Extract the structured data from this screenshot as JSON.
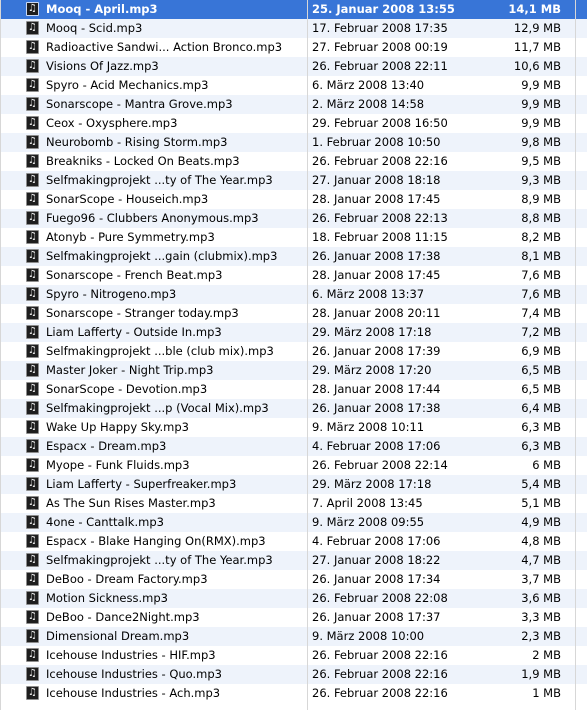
{
  "selection_color": "#3875d7",
  "stripe_color": "#eef3fb",
  "file_icon": "music-file-icon",
  "files": [
    {
      "name": "Mooq - April.mp3",
      "date": "25. Januar 2008 13:55",
      "size": "14,1 MB",
      "selected": true
    },
    {
      "name": "Mooq - Scid.mp3",
      "date": "17. Februar 2008 17:35",
      "size": "12,9 MB"
    },
    {
      "name": "Radioactive Sandwi... Action Bronco.mp3",
      "date": "27. Februar 2008 00:19",
      "size": "11,7 MB"
    },
    {
      "name": "Visions Of Jazz.mp3",
      "date": "26. Februar 2008 22:11",
      "size": "10,6 MB"
    },
    {
      "name": "Spyro - Acid Mechanics.mp3",
      "date": "6. März 2008 13:40",
      "size": "9,9 MB"
    },
    {
      "name": "Sonarscope - Mantra Grove.mp3",
      "date": "2. März 2008 14:58",
      "size": "9,9 MB"
    },
    {
      "name": "Ceox - Oxysphere.mp3",
      "date": "29. Februar 2008 16:50",
      "size": "9,9 MB"
    },
    {
      "name": "Neurobomb - Rising Storm.mp3",
      "date": "1. Februar 2008 10:50",
      "size": "9,8 MB"
    },
    {
      "name": "Breakniks - Locked On Beats.mp3",
      "date": "26. Februar 2008 22:16",
      "size": "9,5 MB"
    },
    {
      "name": "Selfmakingprojekt ...ty of The Year.mp3",
      "date": "27. Januar 2008 18:18",
      "size": "9,3 MB"
    },
    {
      "name": "SonarScope - Houseich.mp3",
      "date": "28. Januar 2008 17:45",
      "size": "8,9 MB"
    },
    {
      "name": "Fuego96 - Clubbers Anonymous.mp3",
      "date": "26. Februar 2008 22:13",
      "size": "8,8 MB"
    },
    {
      "name": "Atonyb - Pure Symmetry.mp3",
      "date": "18. Februar 2008 11:15",
      "size": "8,2 MB"
    },
    {
      "name": "Selfmakingprojekt ...gain (clubmix).mp3",
      "date": "26. Januar 2008 17:38",
      "size": "8,1 MB"
    },
    {
      "name": "Sonarscope - French Beat.mp3",
      "date": "28. Januar 2008 17:45",
      "size": "7,6 MB"
    },
    {
      "name": "Spyro - Nitrogeno.mp3",
      "date": "6. März 2008 13:37",
      "size": "7,6 MB"
    },
    {
      "name": "Sonarscope - Stranger today.mp3",
      "date": "28. Januar 2008 20:11",
      "size": "7,4 MB"
    },
    {
      "name": "Liam Lafferty - Outside In.mp3",
      "date": "29. März 2008 17:18",
      "size": "7,2 MB"
    },
    {
      "name": "Selfmakingprojekt ...ble (club mix).mp3",
      "date": "26. Januar 2008 17:39",
      "size": "6,9 MB"
    },
    {
      "name": "Master Joker - Night Trip.mp3",
      "date": "29. März 2008 17:20",
      "size": "6,5 MB"
    },
    {
      "name": "SonarScope - Devotion.mp3",
      "date": "28. Januar 2008 17:44",
      "size": "6,5 MB"
    },
    {
      "name": "Selfmakingprojekt ...p (Vocal Mix).mp3",
      "date": "26. Januar 2008 17:38",
      "size": "6,4 MB"
    },
    {
      "name": "Wake Up Happy Sky.mp3",
      "date": "9. März 2008 10:11",
      "size": "6,3 MB"
    },
    {
      "name": "Espacx - Dream.mp3",
      "date": "4. Februar 2008 17:06",
      "size": "6,3 MB"
    },
    {
      "name": "Myope - Funk Fluids.mp3",
      "date": "26. Februar 2008 22:14",
      "size": "6 MB"
    },
    {
      "name": "Liam Lafferty - Superfreaker.mp3",
      "date": "29. März 2008 17:18",
      "size": "5,4 MB"
    },
    {
      "name": "As The Sun Rises Master.mp3",
      "date": "7. April 2008 13:45",
      "size": "5,1 MB"
    },
    {
      "name": "4one - Canttalk.mp3",
      "date": "9. März 2008 09:55",
      "size": "4,9 MB"
    },
    {
      "name": "Espacx - Blake Hanging On(RMX).mp3",
      "date": "4. Februar 2008 17:06",
      "size": "4,8 MB"
    },
    {
      "name": "Selfmakingprojekt ...ty of The Year.mp3",
      "date": "27. Januar 2008 18:22",
      "size": "4,7 MB"
    },
    {
      "name": "DeBoo - Dream Factory.mp3",
      "date": "26. Januar 2008 17:34",
      "size": "3,7 MB"
    },
    {
      "name": "Motion Sickness.mp3",
      "date": "26. Februar 2008 22:08",
      "size": "3,6 MB"
    },
    {
      "name": "DeBoo - Dance2Night.mp3",
      "date": "26. Januar 2008 17:37",
      "size": "3,3 MB"
    },
    {
      "name": "Dimensional Dream.mp3",
      "date": "9. März 2008 10:00",
      "size": "2,3 MB"
    },
    {
      "name": "Icehouse Industries - HIF.mp3",
      "date": "26. Februar 2008 22:16",
      "size": "2 MB"
    },
    {
      "name": "Icehouse Industries - Quo.mp3",
      "date": "26. Februar 2008 22:16",
      "size": "1,9 MB"
    },
    {
      "name": "Icehouse Industries - Ach.mp3",
      "date": "26. Februar 2008 22:16",
      "size": "1 MB"
    }
  ]
}
